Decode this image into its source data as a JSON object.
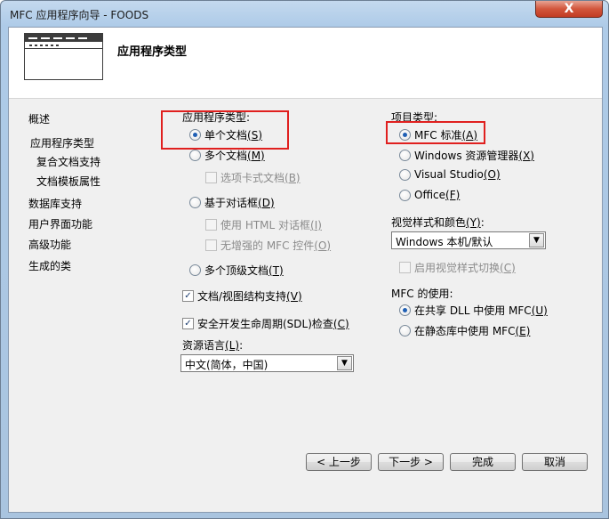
{
  "window": {
    "title": "MFC 应用程序向导 - FOODS",
    "close_glyph": "X"
  },
  "header": {
    "title": "应用程序类型"
  },
  "nav": {
    "items": [
      {
        "label": "概述"
      },
      {
        "label": "应用程序类型"
      },
      {
        "label": "复合文档支持"
      },
      {
        "label": "文档模板属性"
      },
      {
        "label": "数据库支持"
      },
      {
        "label": "用户界面功能"
      },
      {
        "label": "高级功能"
      },
      {
        "label": "生成的类"
      }
    ]
  },
  "app_type": {
    "label": "应用程序类型:",
    "single": {
      "text": "单个文档",
      "key": "(S)",
      "checked": true
    },
    "multiple": {
      "text": "多个文档",
      "key": "(M)",
      "checked": false
    },
    "tabbed": {
      "text": "选项卡式文档",
      "key": "(B)",
      "checked": false,
      "disabled": true
    },
    "dialog": {
      "text": "基于对话框",
      "key": "(D)",
      "checked": false
    },
    "html_dialog": {
      "text": "使用 HTML 对话框",
      "key": "(I)",
      "checked": false,
      "disabled": true
    },
    "no_enhanced": {
      "text": "无增强的 MFC 控件",
      "key": "(O)",
      "checked": false,
      "disabled": true
    },
    "multi_top": {
      "text": "多个顶级文档",
      "key": "(T)",
      "checked": false
    }
  },
  "doc_view": {
    "text": "文档/视图结构支持",
    "key": "(V)",
    "checked": true
  },
  "sdl": {
    "text": "安全开发生命周期(SDL)检查",
    "key": "(C)",
    "checked": true
  },
  "resource_lang": {
    "label": "资源语言",
    "key": "(L)",
    "colon": ":",
    "value": "中文(简体，中国)"
  },
  "project_type": {
    "label": "项目类型:",
    "mfc_standard": {
      "text": "MFC 标准",
      "key": "(A)",
      "checked": true
    },
    "explorer": {
      "text": "Windows 资源管理器",
      "key": "(X)",
      "checked": false
    },
    "visual_studio": {
      "text": "Visual Studio",
      "key": "(O)",
      "checked": false
    },
    "office": {
      "text": "Office",
      "key": "(F)",
      "checked": false
    }
  },
  "visual_style": {
    "label": "视觉样式和颜色",
    "key": "(Y)",
    "colon": ":",
    "value": "Windows 本机/默认",
    "enable_switch": {
      "text": "启用视觉样式切换",
      "key": "(C)",
      "checked": false,
      "disabled": true
    }
  },
  "mfc_use": {
    "label": "MFC 的使用:",
    "shared": {
      "text": "在共享 DLL 中使用 MFC",
      "key": "(U)",
      "checked": true
    },
    "static": {
      "text": "在静态库中使用 MFC",
      "key": "(E)",
      "checked": false
    }
  },
  "buttons": {
    "prev": "< 上一步",
    "next": "下一步 >",
    "finish": "完成",
    "cancel": "取消"
  },
  "icons": {
    "check": "✓",
    "dropdown": "▼"
  },
  "colors": {
    "highlight_box": "#e0201f",
    "radio_dot": "#1f5fb4"
  }
}
